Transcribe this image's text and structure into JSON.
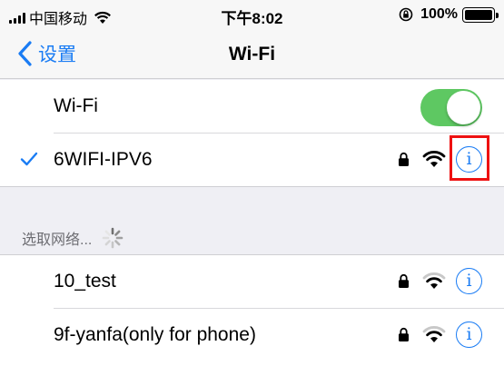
{
  "status_bar": {
    "carrier": "中国移动",
    "time": "下午8:02",
    "battery_percent": "100%",
    "battery_level": 1.0
  },
  "nav": {
    "back_label": "设置",
    "title": "Wi-Fi"
  },
  "wifi_toggle": {
    "label": "Wi-Fi",
    "enabled": true
  },
  "connected_network": {
    "name": "6WIFI-IPV6",
    "secured": true,
    "selected": true
  },
  "networks_section": {
    "header": "选取网络..."
  },
  "networks": [
    {
      "name": "10_test",
      "secured": true
    },
    {
      "name": "9f-yanfa(only for phone)",
      "secured": true
    }
  ],
  "icons": {
    "info_glyph": "i"
  },
  "colors": {
    "accent": "#1a7cf4",
    "toggle_on": "#5ec862",
    "highlight": "#ee1111"
  }
}
